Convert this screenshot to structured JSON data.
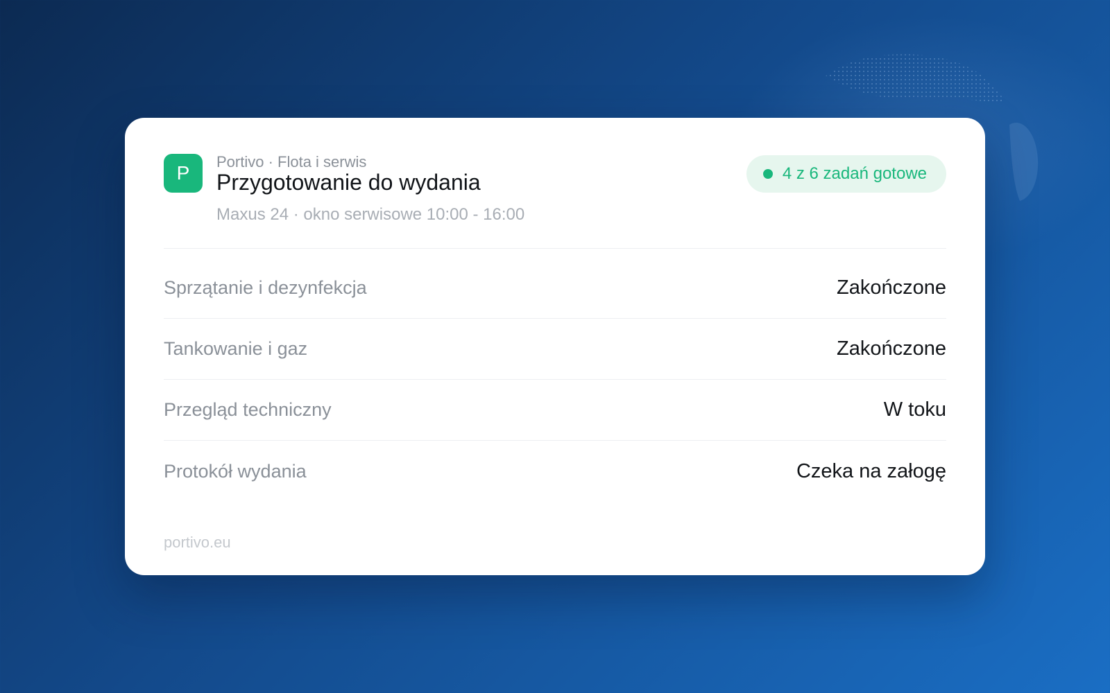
{
  "colors": {
    "accent": "#19b77c",
    "badge_bg": "#e6f6ee",
    "card_bg": "#ffffff",
    "background_start": "#0c2a52",
    "background_end": "#1a6ec4"
  },
  "header": {
    "logo_letter": "P",
    "org": "Portivo · Flota i serwis",
    "title": "Przygotowanie do wydania",
    "subtitle": "Maxus 24 · okno serwisowe 10:00 - 16:00"
  },
  "badge": {
    "text": "4 z 6 zadań gotowe",
    "icon": "status-dot-icon"
  },
  "tasks": [
    {
      "label": "Sprzątanie i dezynfekcja",
      "status": "Zakończone"
    },
    {
      "label": "Tankowanie i gaz",
      "status": "Zakończone"
    },
    {
      "label": "Przegląd techniczny",
      "status": "W toku"
    },
    {
      "label": "Protokół wydania",
      "status": "Czeka na załogę"
    }
  ],
  "footer": {
    "domain": "portivo.eu"
  }
}
